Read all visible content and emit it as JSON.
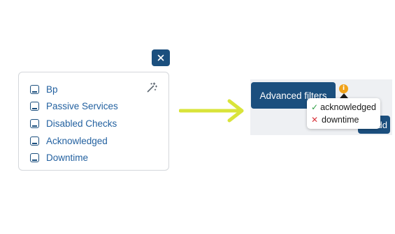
{
  "colors": {
    "primary": "#1b4f7e",
    "link": "#2361a0",
    "arrow": "#d9e43a",
    "warning": "#f0a21a",
    "success": "#2e9e44",
    "danger": "#d9363e",
    "panel_bg": "#eef0f3"
  },
  "filter_menu": {
    "close_label": "×",
    "items": [
      {
        "label": "Bp",
        "checked": false
      },
      {
        "label": "Passive Services",
        "checked": false
      },
      {
        "label": "Disabled Checks",
        "checked": false
      },
      {
        "label": "Acknowledged",
        "checked": false
      },
      {
        "label": "Downtime",
        "checked": false
      }
    ],
    "wand_icon": "magic-wand-icon"
  },
  "advanced": {
    "button_label": "Advanced filters",
    "info_label": "i",
    "add_label": "Add",
    "add_icon": "+",
    "tooltip": {
      "rows": [
        {
          "mark": "✓",
          "text": "acknowledged",
          "status": "included"
        },
        {
          "mark": "✕",
          "text": "downtime",
          "status": "excluded"
        }
      ]
    }
  }
}
